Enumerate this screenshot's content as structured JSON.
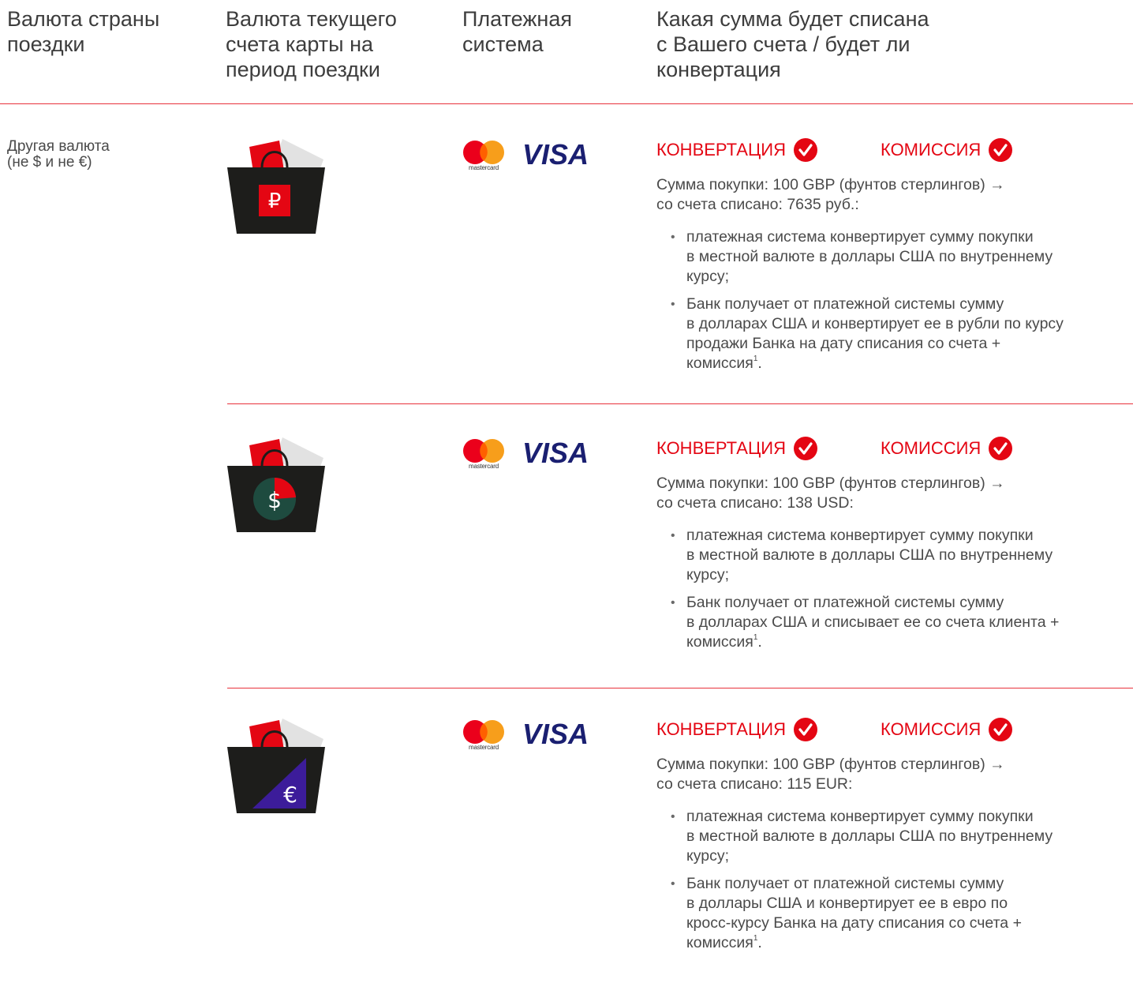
{
  "header": {
    "col1": "Валюта страны\nпоездки",
    "col2": "Валюта текущего\nсчета карты на\nпериод поездки",
    "col3": "Платежная\nсистема",
    "col4": "Какая сумма будет списана\nс Вашего счета / будет ли\nконвертация"
  },
  "country": "Другая валюта\n(не $ и не €)",
  "payment_systems": {
    "mastercard_label": "mastercard",
    "visa_label": "VISA"
  },
  "colors": {
    "accent_red": "#e40613",
    "divider": "#e8323c",
    "bag": "#1d1d1b",
    "dollar_circle": "#1e4b3f",
    "euro_triangle": "#3c1c9a",
    "visa_blue": "#1a1f71",
    "mc_red": "#eb001b",
    "mc_orange": "#f79e1b"
  },
  "rows": [
    {
      "icon": "ruble-bag-icon",
      "currency_symbol": "₽",
      "conversion_label": "КОНВЕРТАЦИЯ",
      "commission_label": "КОМИССИЯ",
      "sum_line1": "Сумма покупки: 100 GBP (фунтов стерлингов) →",
      "sum_line2": "со счета списано: 7635 руб.:",
      "bullet1": "платежная система конвертирует сумму покупки\nв местной валюте в доллары США по внутреннему\nкурсу;",
      "bullet2": "Банк получает от платежной системы сумму\nв долларах США и конвертирует ее в рубли по курсу\nпродажи Банка на дату списания со счета +\nкомиссия",
      "footnote": "1"
    },
    {
      "icon": "dollar-bag-icon",
      "currency_symbol": "$",
      "conversion_label": "КОНВЕРТАЦИЯ",
      "commission_label": "КОМИССИЯ",
      "sum_line1": "Сумма покупки: 100 GBP (фунтов стерлингов) →",
      "sum_line2": "со счета списано: 138 USD:",
      "bullet1": "платежная система конвертирует сумму покупки\nв местной валюте в доллары США по внутреннему\nкурсу;",
      "bullet2": "Банк получает от платежной системы сумму\nв долларах США и списывает ее со счета клиента +\nкомиссия",
      "footnote": "1"
    },
    {
      "icon": "euro-bag-icon",
      "currency_symbol": "€",
      "conversion_label": "КОНВЕРТАЦИЯ",
      "commission_label": "КОМИССИЯ",
      "sum_line1": "Сумма покупки: 100 GBP (фунтов стерлингов) →",
      "sum_line2": "со счета списано: 115 EUR:",
      "bullet1": "платежная система конвертирует сумму покупки\nв местной валюте в доллары США по внутреннему\nкурсу;",
      "bullet2": "Банк получает от платежной системы сумму\nв доллары США и конвертирует ее в евро по\nкросс-курсу Банка на дату списания со счета +\nкомиссия",
      "footnote": "1"
    }
  ]
}
